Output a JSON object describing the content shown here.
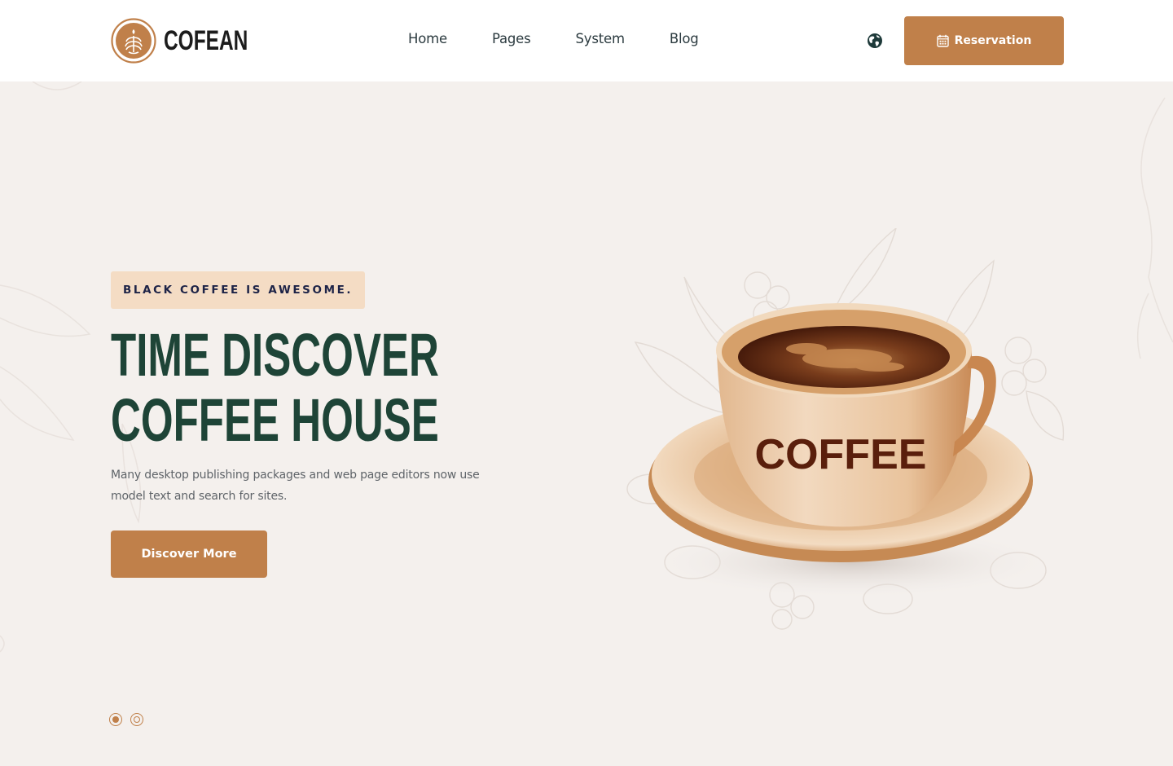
{
  "brand": {
    "name": "COFEAN",
    "accent_color": "#c0804a",
    "heading_color": "#1e4437"
  },
  "nav": {
    "items": [
      {
        "label": "Home"
      },
      {
        "label": "Pages"
      },
      {
        "label": "System"
      },
      {
        "label": "Blog"
      }
    ],
    "language_icon": "globe-icon",
    "reservation_label": "Reservation",
    "reservation_icon": "calendar-icon"
  },
  "hero": {
    "tagline": "BLACK COFFEE IS AWESOME.",
    "headline_line1": "TIME DISCOVER",
    "headline_line2": "COFFEE HOUSE",
    "description": "Many desktop publishing packages and web page editors now use model text and search for sites.",
    "cta_label": "Discover More",
    "cup_label": "COFFEE",
    "slides": [
      {
        "active": true
      },
      {
        "active": false
      }
    ]
  }
}
